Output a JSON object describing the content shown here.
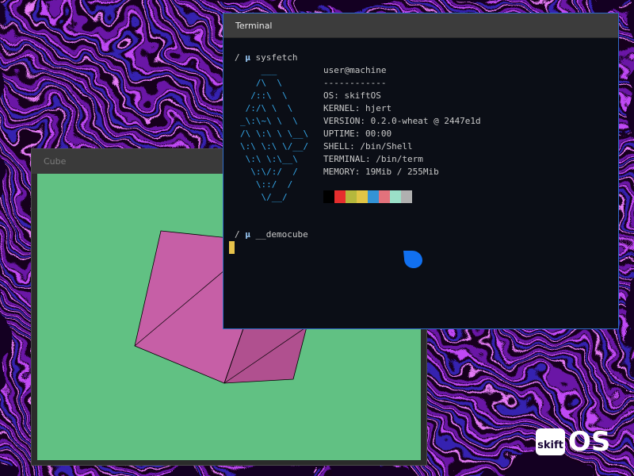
{
  "desktop": {
    "logo_box_text": "skift",
    "logo_os_text": "OS",
    "wallpaper_colors": [
      "#100018",
      "#5a0e8c",
      "#b43cf0",
      "#2a1a9a",
      "#e86ef7"
    ]
  },
  "cube_window": {
    "title": "Cube",
    "canvas_color": "#61c183",
    "cube_color": "#c65fa6",
    "cube_shade_color": "#b0508f"
  },
  "terminal_window": {
    "title": "Terminal",
    "prompt_path": "/",
    "prompt_symbol": "µ",
    "command_1": "sysfetch",
    "command_2": "__democube",
    "logo_lines": [
      "    ___",
      "   /\\  \\",
      "  /::\\  \\",
      " /:/\\ \\  \\",
      "_\\:\\~\\ \\  \\",
      "/\\ \\:\\ \\ \\__\\",
      "\\:\\ \\:\\ \\/__/",
      " \\:\\ \\:\\__\\",
      "  \\:\\/:/  /",
      "   \\::/  /",
      "    \\/__/"
    ],
    "info_lines": [
      "user@machine",
      "------------",
      "OS: skiftOS",
      "KERNEL: hjert",
      "VERSION: 0.2.0-wheat @ 2447e1d",
      "UPTIME: 00:00",
      "SHELL: /bin/Shell",
      "TERMINAL: /bin/term",
      "MEMORY: 19Mib / 255Mib"
    ],
    "palette": [
      "#000000",
      "#e62e2e",
      "#b5b83c",
      "#e1c545",
      "#3393d6",
      "#e3727c",
      "#9be0c8",
      "#b0b0b0"
    ],
    "cursor_color": "#e6c24a",
    "accent_color": "#1170f0"
  }
}
